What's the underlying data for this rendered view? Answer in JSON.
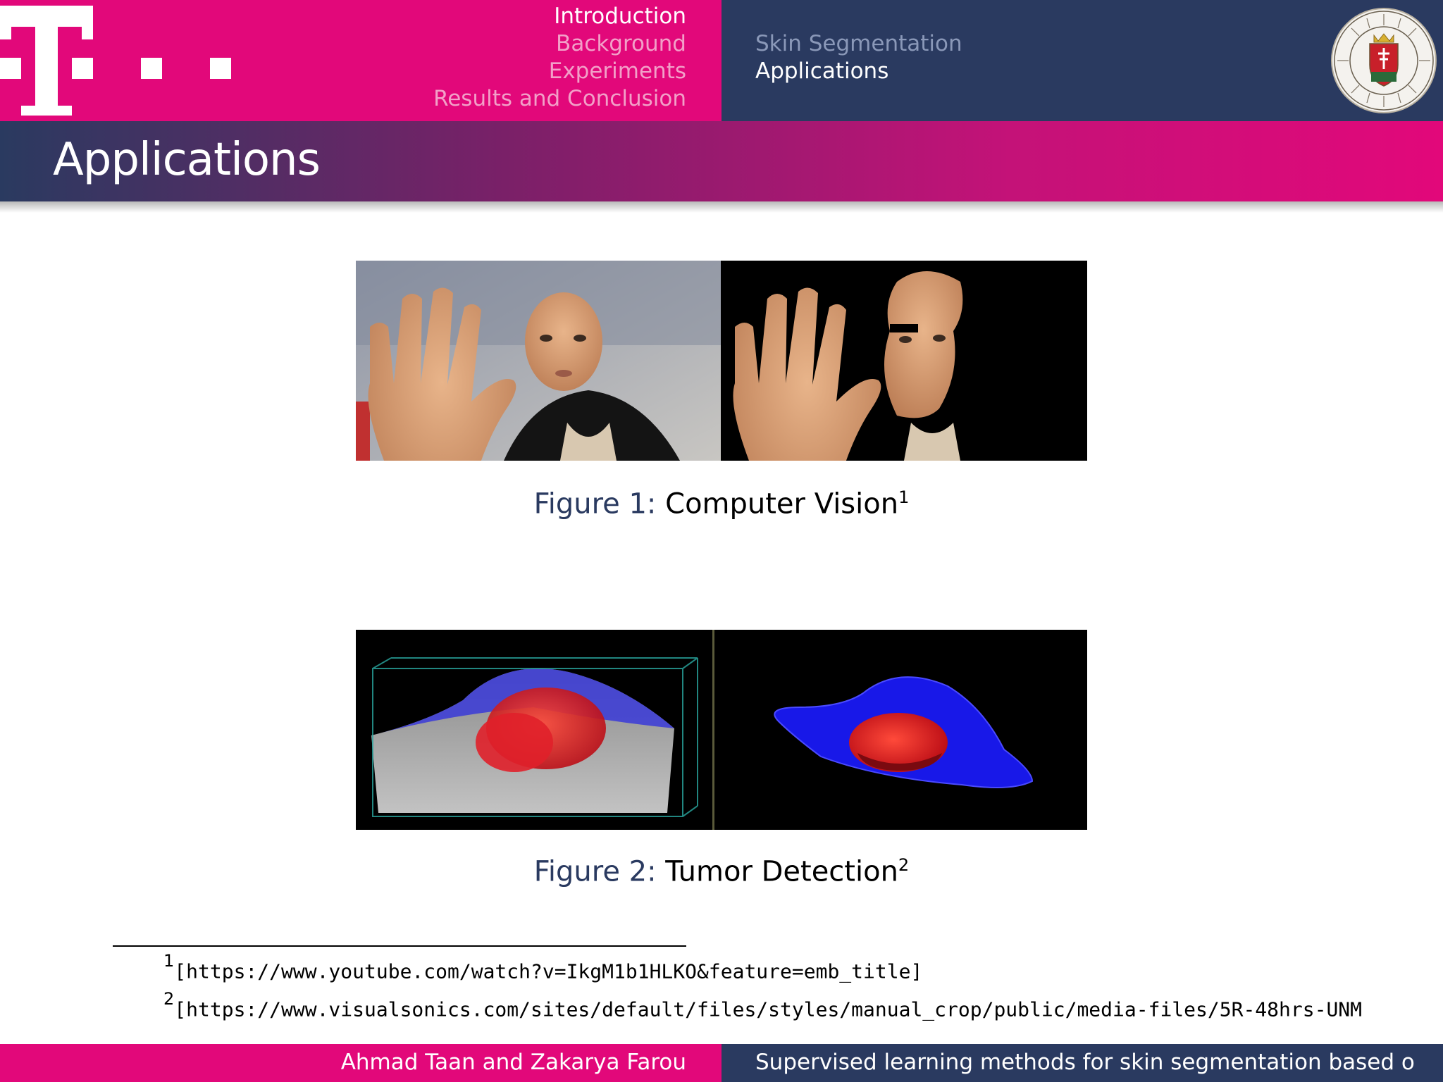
{
  "header": {
    "sections_left": [
      "Introduction",
      "Background",
      "Experiments",
      "Results and Conclusion"
    ],
    "sections_right": [
      "Skin Segmentation",
      "Applications"
    ],
    "logo_icon": "telekom-t-logo",
    "seal_icon": "university-seal-icon"
  },
  "slide": {
    "title": "Applications"
  },
  "figures": [
    {
      "label": "Figure 1:",
      "caption": "Computer Vision",
      "footnote_mark": "1"
    },
    {
      "label": "Figure 2:",
      "caption": "Tumor Detection",
      "footnote_mark": "2"
    }
  ],
  "footnotes": [
    {
      "mark": "1",
      "text": "[https://www.youtube.com/watch?v=IkgM1b1HLKO&feature=emb_title]"
    },
    {
      "mark": "2",
      "text": "[https://www.visualsonics.com/sites/default/files/styles/manual_crop/public/media-files/5R-48hrs-UNM"
    }
  ],
  "footer": {
    "authors": "Ahmad Taan and Zakarya Farou",
    "talk_title": "Supervised learning methods for skin segmentation based o"
  },
  "colors": {
    "magenta": "#e2087a",
    "navy": "#2a3a60"
  }
}
